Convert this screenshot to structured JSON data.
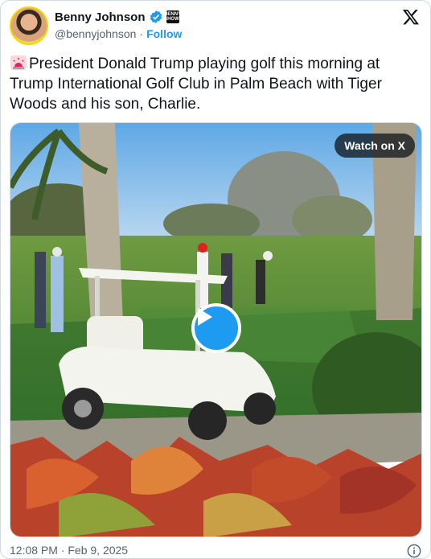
{
  "author": {
    "name": "Benny Johnson",
    "handle": "@bennyjohnson",
    "separator": "·",
    "follow_label": "Follow",
    "badge_text": "BENNY SHOW",
    "verified_icon": "verified-badge-icon"
  },
  "tweet": {
    "text": "President Donald Trump playing golf this morning at Trump International Golf Club in Palm Beach with Tiger Woods and his son, Charlie.",
    "leading_icon": "siren-icon"
  },
  "media": {
    "watch_label": "Watch on X",
    "play_icon": "play-icon"
  },
  "footer": {
    "timestamp": "12:08 PM · Feb 9, 2025",
    "info_icon": "info-icon"
  },
  "colors": {
    "accent": "#1d9bf0",
    "text": "#0f1419",
    "muted": "#536471",
    "border": "#cfd9de"
  }
}
